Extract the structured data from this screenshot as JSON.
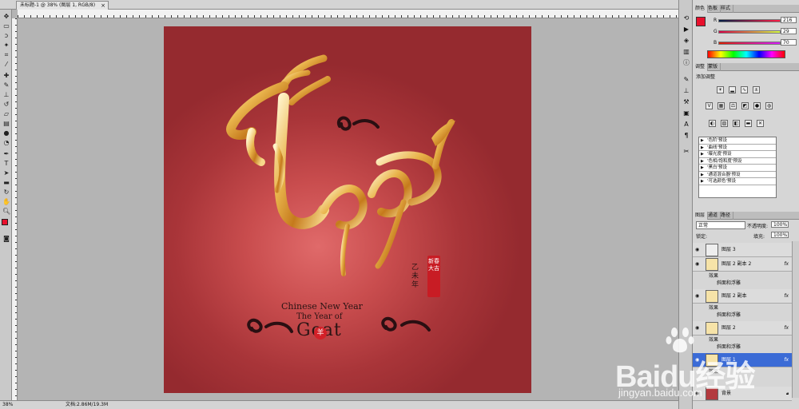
{
  "document_tab": {
    "title": "未标题-1 @ 38% (图层 1, RGB/8)"
  },
  "status_bar": {
    "zoom": "38%",
    "doc_size": "文档:2.86M/19.3M"
  },
  "canvas": {
    "caption_1": "Chinese New Year",
    "caption_2": "The Year of",
    "caption_3": "Goat",
    "red_dot": "羊",
    "small_chars": "乙未年",
    "stamp": "新春大吉"
  },
  "color_panel": {
    "tabs": [
      "颜色",
      "色板",
      "样式"
    ],
    "r_label": "R",
    "g_label": "G",
    "b_label": "B",
    "r_value": "216",
    "g_value": "29",
    "b_value": "70",
    "fg_color": "#e8102c"
  },
  "adjust_panel": {
    "tabs": [
      "调整",
      "蒙版"
    ],
    "title": "添加调整",
    "presets": [
      "'色阶'预设",
      "'曲线'预设",
      "'曝光度'预设",
      "'色相/饱和度'预设",
      "'黑白'预设",
      "'通道混合器'预设",
      "'可选颜色'预设"
    ]
  },
  "layers_panel": {
    "tabs": [
      "图层",
      "通道",
      "路径"
    ],
    "blend_mode": "正常",
    "opacity_label": "不透明度:",
    "opacity_value": "100%",
    "lock_label": "锁定:",
    "fill_label": "填充:",
    "fill_value": "100%",
    "layers": [
      {
        "name": "图层 3",
        "fx": ""
      },
      {
        "name": "图层 2 副本 2",
        "fx": "fx"
      },
      {
        "name": "效果",
        "sub": true
      },
      {
        "name": "斜面和浮雕",
        "sub": true
      },
      {
        "name": "图层 2 副本",
        "fx": "fx"
      },
      {
        "name": "效果",
        "sub": true
      },
      {
        "name": "斜面和浮雕",
        "sub": true
      },
      {
        "name": "图层 2",
        "fx": "fx"
      },
      {
        "name": "效果",
        "sub": true
      },
      {
        "name": "斜面和浮雕",
        "sub": true
      },
      {
        "name": "图层 1",
        "fx": "fx"
      },
      {
        "name": "效果",
        "sub": true
      },
      {
        "name": "背景",
        "fx": ""
      }
    ]
  },
  "watermark": {
    "brand": "Baidu经验",
    "url": "jingyan.baidu.com"
  }
}
